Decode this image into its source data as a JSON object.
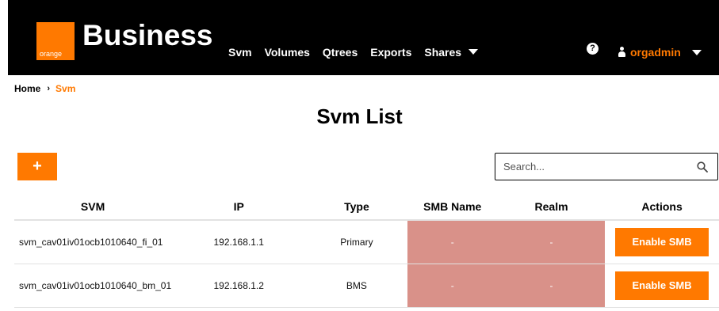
{
  "header": {
    "logo_text": "orange",
    "brand": "Business",
    "nav": [
      "Svm",
      "Volumes",
      "Qtrees",
      "Exports",
      "Shares"
    ],
    "help_icon": "?",
    "user_name": "orgadmin"
  },
  "breadcrumb": {
    "home": "Home",
    "separator": "›",
    "current": "Svm"
  },
  "page_title": "Svm List",
  "add_button_label": "+",
  "search": {
    "placeholder": "Search...",
    "value": ""
  },
  "table": {
    "columns": [
      "SVM",
      "IP",
      "Type",
      "SMB Name",
      "Realm",
      "Actions"
    ],
    "rows": [
      {
        "svm": "svm_cav01iv01ocb1010640_fi_01",
        "ip": "192.168.1.1",
        "type": "Primary",
        "smb_name": "-",
        "realm": "-",
        "action": "Enable SMB"
      },
      {
        "svm": "svm_cav01iv01ocb1010640_bm_01",
        "ip": "192.168.1.2",
        "type": "BMS",
        "smb_name": "-",
        "realm": "-",
        "action": "Enable SMB"
      }
    ]
  },
  "colors": {
    "accent": "#ff7900",
    "header_bg": "#000000",
    "shaded_cell": "#d99189"
  }
}
